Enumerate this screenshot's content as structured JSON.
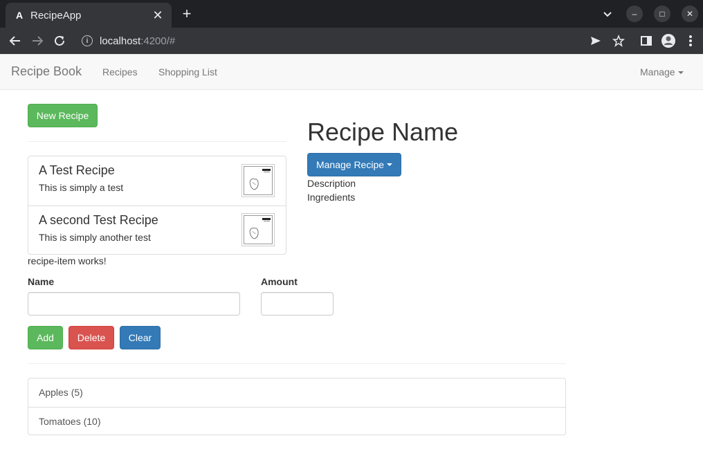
{
  "browser": {
    "tab_title": "RecipeApp",
    "tab_favicon": "A",
    "url_host": "localhost",
    "url_rest": ":4200/#"
  },
  "navbar": {
    "brand": "Recipe Book",
    "links": [
      "Recipes",
      "Shopping List"
    ],
    "manage": "Manage"
  },
  "recipes": {
    "new_button": "New Recipe",
    "items": [
      {
        "name": "A Test Recipe",
        "description": "This is simply a test"
      },
      {
        "name": "A second Test Recipe",
        "description": "This is simply another test"
      }
    ],
    "works_text": "recipe-item works!"
  },
  "detail": {
    "title": "Recipe Name",
    "manage_button": "Manage Recipe",
    "description_label": "Description",
    "ingredients_label": "Ingredients"
  },
  "shopping": {
    "name_label": "Name",
    "amount_label": "Amount",
    "name_value": "",
    "amount_value": "",
    "add_button": "Add",
    "delete_button": "Delete",
    "clear_button": "Clear",
    "items": [
      "Apples (5)",
      "Tomatoes (10)"
    ]
  },
  "colors": {
    "success": "#5cb85c",
    "danger": "#d9534f",
    "primary": "#337ab7"
  }
}
